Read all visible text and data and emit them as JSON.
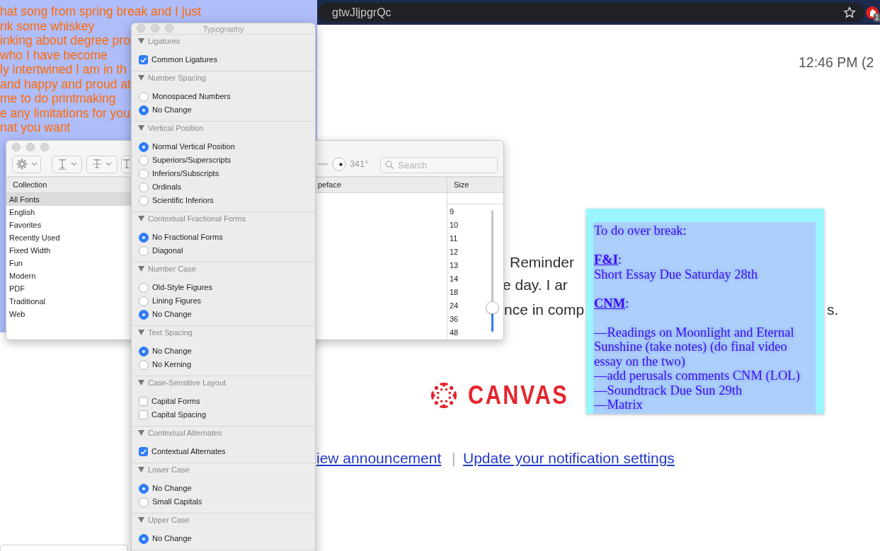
{
  "browser": {
    "address_fragment": "gtwJljpgrQc",
    "extension_badge": "1",
    "time": "12:46 PM (2",
    "body_fragments": [
      {
        "kind": "a",
        "text": "Reminder"
      },
      {
        "kind": "b",
        "text": "e day.  I ar"
      },
      {
        "kind": "c",
        "text": "nce in comp"
      },
      {
        "kind": "d",
        "text": "s."
      }
    ],
    "logo_text": "CANVAS",
    "links": [
      "iew announcement ",
      "Update your notification settings"
    ],
    "link_separator": "|"
  },
  "stickies_note": {
    "lines": [
      {
        "kind": "text",
        "text": "hat song from spring break and I just"
      },
      {
        "kind": "text",
        "text": "nk some whiskey"
      },
      {
        "kind": "text",
        "text": "inking about degree pro"
      },
      {
        "kind": "text",
        "text": "who I have become"
      },
      {
        "kind": "text",
        "text": "ly intertwined I am in th"
      },
      {
        "kind": "text",
        "text": "and happy and proud at"
      },
      {
        "kind": "text",
        "text": "me to do printmaking"
      },
      {
        "kind": "text",
        "text": "e any limitations for you"
      },
      {
        "kind": "text",
        "text": "nat you want"
      }
    ]
  },
  "font_panel": {
    "rotation": "341°",
    "search": {
      "placeholder": "Search"
    },
    "columns": [
      "Collection",
      "peface",
      "Size"
    ],
    "collections": [
      {
        "label": "All Fonts",
        "selected": true
      },
      {
        "label": "English",
        "selected": false
      },
      {
        "label": "Favorites",
        "selected": false
      },
      {
        "label": "Recently Used",
        "selected": false
      },
      {
        "label": "Fixed Width",
        "selected": false
      },
      {
        "label": "Fun",
        "selected": false
      },
      {
        "label": "Modern",
        "selected": false
      },
      {
        "label": "PDF",
        "selected": false
      },
      {
        "label": "Traditional",
        "selected": false
      },
      {
        "label": "Web",
        "selected": false
      }
    ],
    "sizes": [
      "9",
      "10",
      "11",
      "12",
      "13",
      "14",
      "18",
      "24",
      "36",
      "48"
    ],
    "size_slider": {
      "level": 0.2
    }
  },
  "typography": {
    "title": "Typography",
    "sections": [
      {
        "title": "Ligatures",
        "options": [
          {
            "kind": "checkbox",
            "label": "Common Ligatures",
            "checked": true
          }
        ]
      },
      {
        "title": "Number Spacing",
        "options": [
          {
            "kind": "radio",
            "label": "Monospaced Numbers",
            "checked": false
          },
          {
            "kind": "radio",
            "label": "No Change",
            "checked": true
          }
        ]
      },
      {
        "title": "Vertical Position",
        "options": [
          {
            "kind": "radio",
            "label": "Normal Vertical Position",
            "checked": true
          },
          {
            "kind": "radio",
            "label": "Superiors/Superscripts",
            "checked": false
          },
          {
            "kind": "radio",
            "label": "Inferiors/Subscripts",
            "checked": false
          },
          {
            "kind": "radio",
            "label": "Ordinals",
            "checked": false
          },
          {
            "kind": "radio",
            "label": "Scientific Inferiors",
            "checked": false
          }
        ]
      },
      {
        "title": "Contextual Fractional Forms",
        "options": [
          {
            "kind": "radio",
            "label": "No Fractional Forms",
            "checked": true
          },
          {
            "kind": "radio",
            "label": "Diagonal",
            "checked": false
          }
        ]
      },
      {
        "title": "Number Case",
        "options": [
          {
            "kind": "radio",
            "label": "Old-Style Figures",
            "checked": false
          },
          {
            "kind": "radio",
            "label": "Lining Figures",
            "checked": false
          },
          {
            "kind": "radio",
            "label": "No Change",
            "checked": true
          }
        ]
      },
      {
        "title": "Text Spacing",
        "options": [
          {
            "kind": "radio",
            "label": "No Change",
            "checked": true
          },
          {
            "kind": "radio",
            "label": "No Kerning",
            "checked": false
          }
        ]
      },
      {
        "title": "Case-Sensitive Layout",
        "options": [
          {
            "kind": "checkbox",
            "label": "Capital Forms",
            "checked": false
          },
          {
            "kind": "checkbox",
            "label": "Capital Spacing",
            "checked": false
          }
        ]
      },
      {
        "title": "Contextual Alternates",
        "options": [
          {
            "kind": "checkbox",
            "label": "Contextual Alternates",
            "checked": true
          }
        ]
      },
      {
        "title": "Lower Case",
        "options": [
          {
            "kind": "radio",
            "label": "No Change",
            "checked": true
          },
          {
            "kind": "radio",
            "label": "Small Capitals",
            "checked": false
          }
        ]
      },
      {
        "title": "Upper Case",
        "options": [
          {
            "kind": "radio",
            "label": "No Change",
            "checked": true
          }
        ]
      }
    ]
  },
  "todo_note": {
    "lines": [
      {
        "kind": "text",
        "text": "To do over break:"
      },
      {
        "kind": "gap"
      },
      {
        "kind": "heading",
        "title": "F&I",
        "suffix": ":"
      },
      {
        "kind": "text",
        "text": "Short Essay Due Saturday 28th"
      },
      {
        "kind": "gap"
      },
      {
        "kind": "heading",
        "title": "CNM",
        "suffix": ":"
      },
      {
        "kind": "gap"
      },
      {
        "kind": "text",
        "text": "—Readings on Moonlight and Eternal Sunshine (take notes) (do final video essay on the two)"
      },
      {
        "kind": "text",
        "text": "—add perusals comments CNM (LOL)"
      },
      {
        "kind": "text",
        "text": "—Soundtrack Due Sun 29th"
      },
      {
        "kind": "text",
        "text": "—Matrix"
      }
    ]
  }
}
